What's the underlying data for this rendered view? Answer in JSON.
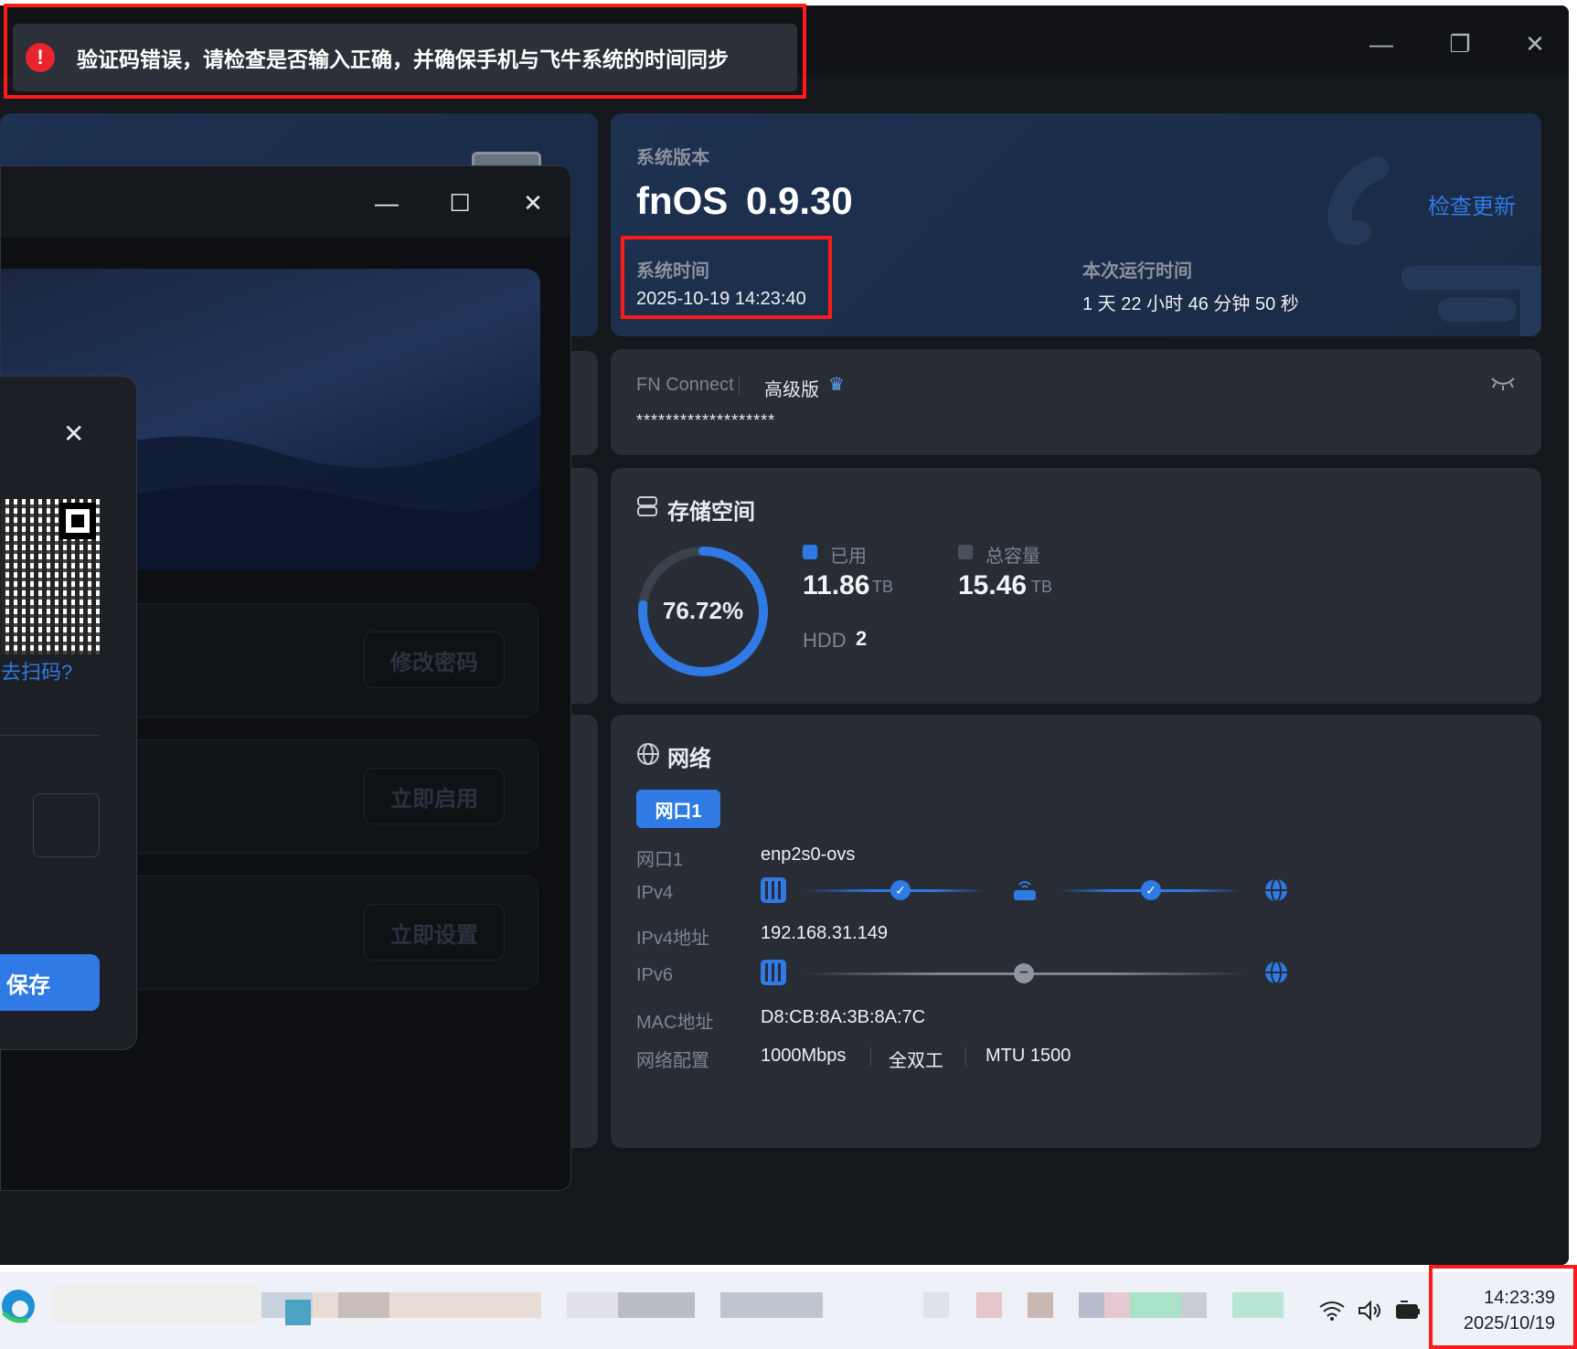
{
  "toast": {
    "icon": "error-icon",
    "message": "验证码错误，请检查是否输入正确，并确保手机与飞牛系统的时间同步"
  },
  "app_window": {
    "controls": {
      "minimize": "—",
      "restore": "❐",
      "close": "✕"
    }
  },
  "system_card": {
    "version_label": "系统版本",
    "os_name": "fnOS",
    "os_version": "0.9.30",
    "check_update": "检查更新",
    "time_label": "系统时间",
    "time_value": "2025-10-19 14:23:40",
    "uptime_label": "本次运行时间",
    "uptime_value": "1 天 22 小时 46 分钟 50 秒"
  },
  "connect_card": {
    "title": "FN Connect",
    "edition": "高级版",
    "masked_id": "*******************"
  },
  "storage_card": {
    "title": "存储空间",
    "used_percent_text": "76.72%",
    "used_fraction": 0.7672,
    "used_label": "已用",
    "used_value": "11.86",
    "used_unit": "TB",
    "total_label": "总容量",
    "total_value": "15.46",
    "total_unit": "TB",
    "hdd_label": "HDD",
    "hdd_count": "2"
  },
  "network_card": {
    "title": "网络",
    "tab_label": "网口1",
    "rows": {
      "port_label": "网口1",
      "port_value": "enp2s0-ovs",
      "ipv4_label": "IPv4",
      "ipv4_addr_label": "IPv4地址",
      "ipv4_addr_value": "192.168.31.149",
      "ipv6_label": "IPv6",
      "mac_label": "MAC地址",
      "mac_value": "D8:CB:8A:3B:8A:7C",
      "config_label": "网络配置",
      "speed": "1000Mbps",
      "duplex": "全双工",
      "mtu": "MTU 1500"
    }
  },
  "behind_window": {
    "controls": {
      "minimize": "—",
      "maximize": "☐",
      "close": "✕"
    },
    "actions": [
      "修改密码",
      "立即启用",
      "立即设置"
    ]
  },
  "dialog": {
    "close": "✕",
    "scan_hint": "去扫码?",
    "save_label": "保存"
  },
  "taskbar": {
    "time": "14:23:39",
    "date": "2025/10/19"
  },
  "colors": {
    "accent": "#2f7ae5",
    "error": "#e8242f",
    "highlight_box": "#ff1a1a"
  }
}
